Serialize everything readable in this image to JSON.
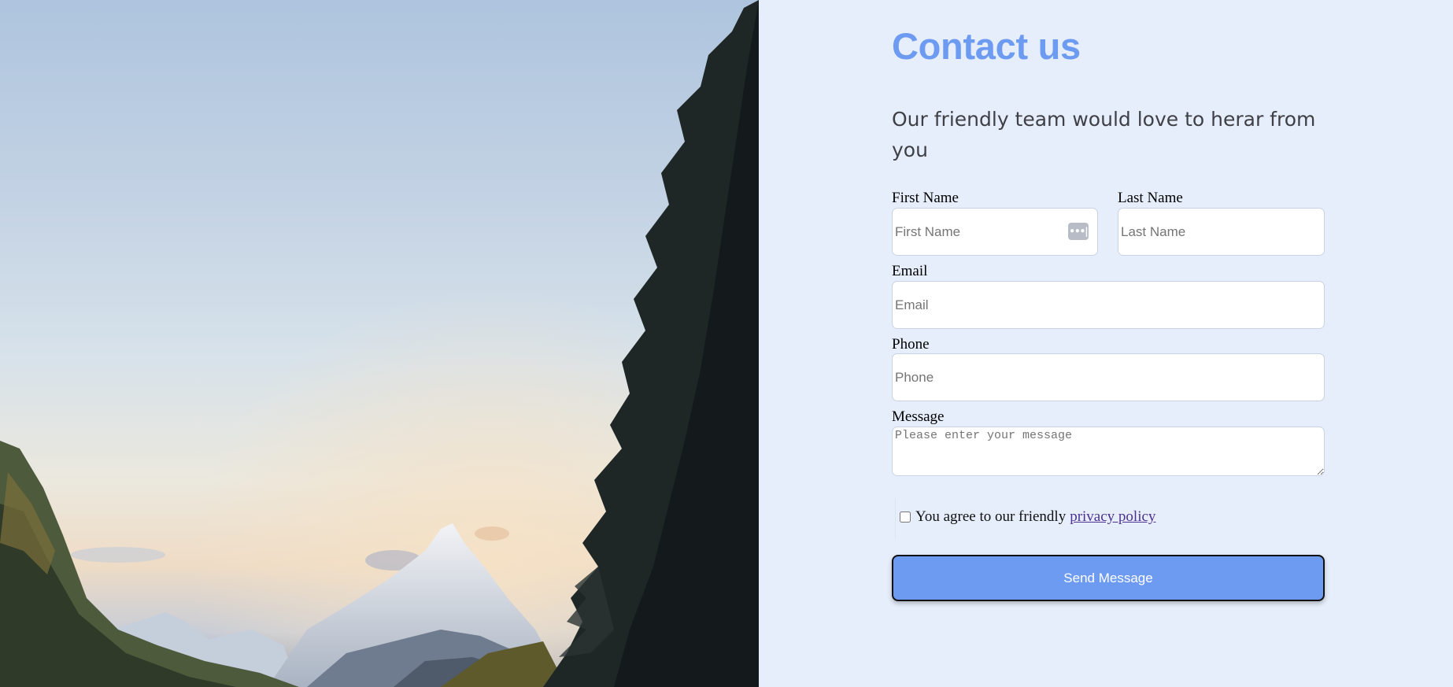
{
  "page": {
    "title": "Contact us",
    "subtitle": "Our friendly team would love to herar from you"
  },
  "form": {
    "first_name": {
      "label": "First Name",
      "placeholder": "First Name",
      "value": ""
    },
    "last_name": {
      "label": "Last Name",
      "placeholder": "Last Name",
      "value": ""
    },
    "email": {
      "label": "Email",
      "placeholder": "Email",
      "value": ""
    },
    "phone": {
      "label": "Phone",
      "placeholder": "Phone",
      "value": ""
    },
    "message": {
      "label": "Message",
      "placeholder": "Please enter your message",
      "value": ""
    },
    "agree": {
      "text": "You agree to our friendly",
      "link": "privacy policy",
      "checked": false
    },
    "submit_label": "Send Message"
  },
  "image": {
    "subject": "mountain-landscape"
  },
  "colors": {
    "accent": "#6e9bf2",
    "panel_bg": "#e6eefb",
    "link": "#4d3192"
  }
}
